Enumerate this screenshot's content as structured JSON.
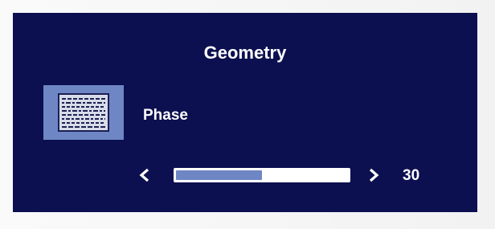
{
  "menu": {
    "title": "Geometry",
    "item_label": "Phase",
    "icon": "phase-pattern-icon",
    "value": "30",
    "level": 0.5,
    "colors": {
      "background": "#0c1050",
      "accent": "#6f86c4",
      "text": "#ffffff",
      "track": "#ffffff"
    }
  }
}
